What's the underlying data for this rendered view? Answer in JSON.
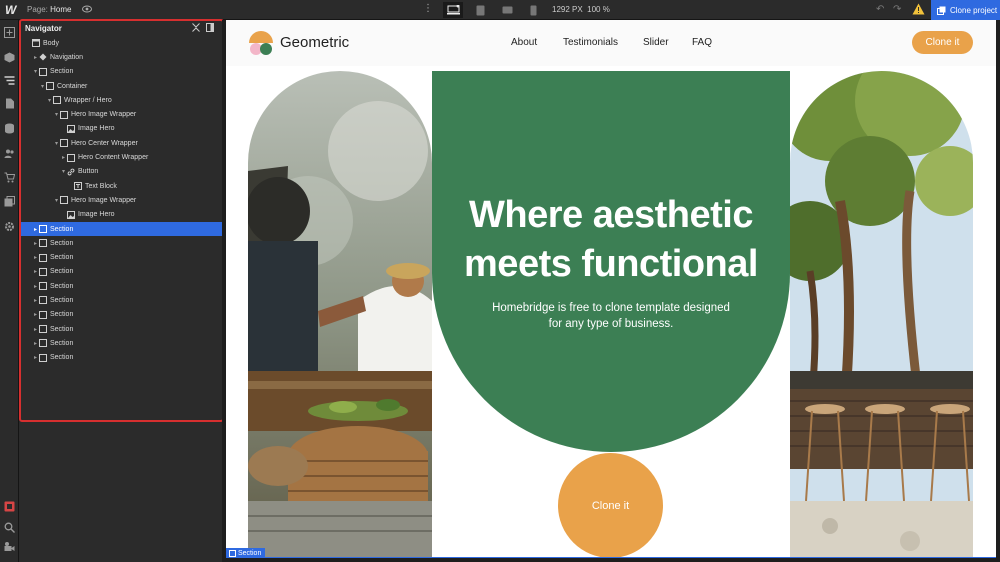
{
  "topbar": {
    "logo": "W",
    "page_prefix": "Page:",
    "page_name": "Home",
    "viewport_width": "1292 PX",
    "zoom": "100 %",
    "clone_project": "Clone project"
  },
  "navigator": {
    "title": "Navigator",
    "tree": [
      {
        "label": "Body",
        "depth": 0,
        "icon": "body",
        "toggle": ""
      },
      {
        "label": "Navigation",
        "depth": 1,
        "icon": "symbol",
        "toggle": "▸"
      },
      {
        "label": "Section",
        "depth": 1,
        "icon": "box",
        "toggle": "▾"
      },
      {
        "label": "Container",
        "depth": 2,
        "icon": "box",
        "toggle": "▾"
      },
      {
        "label": "Wrapper / Hero",
        "depth": 3,
        "icon": "box",
        "toggle": "▾"
      },
      {
        "label": "Hero Image Wrapper",
        "depth": 4,
        "icon": "box",
        "toggle": "▾"
      },
      {
        "label": "Image Hero",
        "depth": 5,
        "icon": "image",
        "toggle": ""
      },
      {
        "label": "Hero Center Wrapper",
        "depth": 4,
        "icon": "box",
        "toggle": "▾"
      },
      {
        "label": "Hero Content Wrapper",
        "depth": 5,
        "icon": "box",
        "toggle": "▸"
      },
      {
        "label": "Button",
        "depth": 5,
        "icon": "link",
        "toggle": "▾"
      },
      {
        "label": "Text Block",
        "depth": 6,
        "icon": "text",
        "toggle": ""
      },
      {
        "label": "Hero Image Wrapper",
        "depth": 4,
        "icon": "box",
        "toggle": "▾"
      },
      {
        "label": "Image Hero",
        "depth": 5,
        "icon": "image",
        "toggle": ""
      },
      {
        "label": "Section",
        "depth": 1,
        "icon": "box",
        "toggle": "▸",
        "selected": true
      },
      {
        "label": "Section",
        "depth": 1,
        "icon": "box",
        "toggle": "▸"
      },
      {
        "label": "Section",
        "depth": 1,
        "icon": "box",
        "toggle": "▸"
      },
      {
        "label": "Section",
        "depth": 1,
        "icon": "box",
        "toggle": "▸"
      },
      {
        "label": "Section",
        "depth": 1,
        "icon": "box",
        "toggle": "▸"
      },
      {
        "label": "Section",
        "depth": 1,
        "icon": "box",
        "toggle": "▸"
      },
      {
        "label": "Section",
        "depth": 1,
        "icon": "box",
        "toggle": "▸"
      },
      {
        "label": "Section",
        "depth": 1,
        "icon": "box",
        "toggle": "▸"
      },
      {
        "label": "Section",
        "depth": 1,
        "icon": "box",
        "toggle": "▸"
      },
      {
        "label": "Section",
        "depth": 1,
        "icon": "box",
        "toggle": "▸"
      }
    ]
  },
  "site": {
    "brand": "Geometric",
    "menu": [
      "About",
      "Testimonials",
      "Slider",
      "FAQ"
    ],
    "nav_cta": "Clone it",
    "hero_title": "Where aesthetic meets functional",
    "hero_subtitle": "Homebridge is free to clone template designed for any type of business.",
    "hero_cta": "Clone it"
  },
  "selection_tag": "Section",
  "colors": {
    "accent_blue": "#2f6ae0",
    "hero_green": "#3c7f54",
    "cta_orange": "#e9a24a",
    "highlight_red": "#d62f2f"
  }
}
